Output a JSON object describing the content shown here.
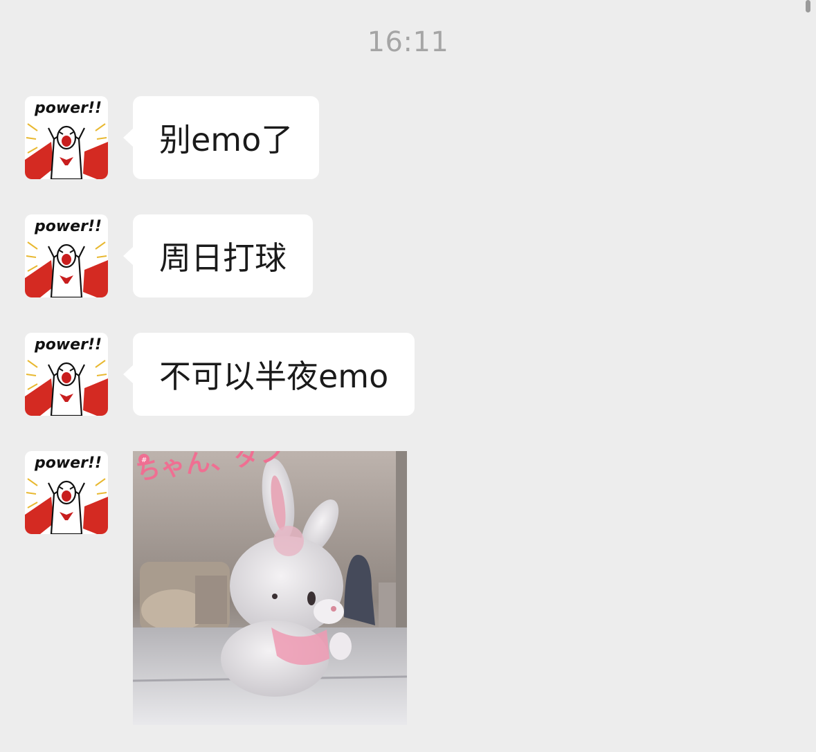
{
  "chat": {
    "timestamp": "16:11",
    "avatar_caption": "power!!",
    "messages": [
      {
        "type": "text",
        "text": "别emo了"
      },
      {
        "type": "text",
        "text": "周日打球"
      },
      {
        "type": "text",
        "text": "不可以半夜emo"
      },
      {
        "type": "sticker",
        "caption": "ちゃん、ダン",
        "icon": "plush-bunny-sticker"
      }
    ]
  }
}
